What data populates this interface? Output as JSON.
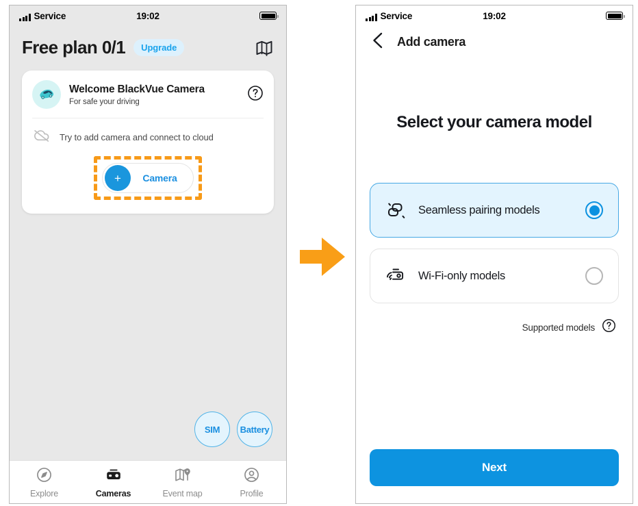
{
  "screens": [
    {
      "id": "cameras-home",
      "status_bar": {
        "carrier": "Service",
        "signal_icon": "signal-bars-icon",
        "time": "19:02",
        "battery_icon": "battery-full-icon"
      },
      "header": {
        "plan_title": "Free plan 0/1",
        "upgrade_label": "Upgrade",
        "map_icon": "map-icon"
      },
      "welcome_card": {
        "avatar_icon": "car-icon",
        "title": "Welcome BlackVue Camera",
        "subtitle": "For safe your driving",
        "help_icon": "question-circle-icon",
        "cloud_icon": "cloud-off-icon",
        "cloud_text": "Try to add camera and connect to cloud",
        "add_button": {
          "plus_icon": "plus-icon",
          "label": "Camera",
          "highlight_color": "#f79a18"
        }
      },
      "floating_buttons": [
        {
          "label": "SIM",
          "name": "sim-fab"
        },
        {
          "label": "Battery",
          "name": "battery-fab"
        }
      ],
      "tab_bar": [
        {
          "label": "Explore",
          "icon": "compass-icon",
          "active": false
        },
        {
          "label": "Cameras",
          "icon": "dashcam-icon",
          "active": true
        },
        {
          "label": "Event map",
          "icon": "map-pin-icon",
          "active": false
        },
        {
          "label": "Profile",
          "icon": "account-icon",
          "active": false
        }
      ]
    },
    {
      "id": "add-camera",
      "status_bar": {
        "carrier": "Service",
        "signal_icon": "signal-bars-icon",
        "time": "19:02",
        "battery_icon": "battery-full-icon"
      },
      "nav": {
        "back_icon": "chevron-left-icon",
        "title": "Add camera"
      },
      "heading": "Select your camera model",
      "options": [
        {
          "label": "Seamless pairing models",
          "icon": "link-chain-icon",
          "selected": true
        },
        {
          "label": "Wi-Fi-only models",
          "icon": "wifi-camera-icon",
          "selected": false
        }
      ],
      "supported": {
        "text": "Supported models",
        "help_icon": "question-circle-icon"
      },
      "primary_button": "Next"
    }
  ],
  "flow_arrow": {
    "icon": "arrow-right-icon",
    "color": "#f99e17"
  },
  "theme": {
    "accent": "#0d93e0",
    "accent_light": "#e3f4fe",
    "highlight": "#f79a18",
    "screen_bg": "#e8e8e8"
  }
}
